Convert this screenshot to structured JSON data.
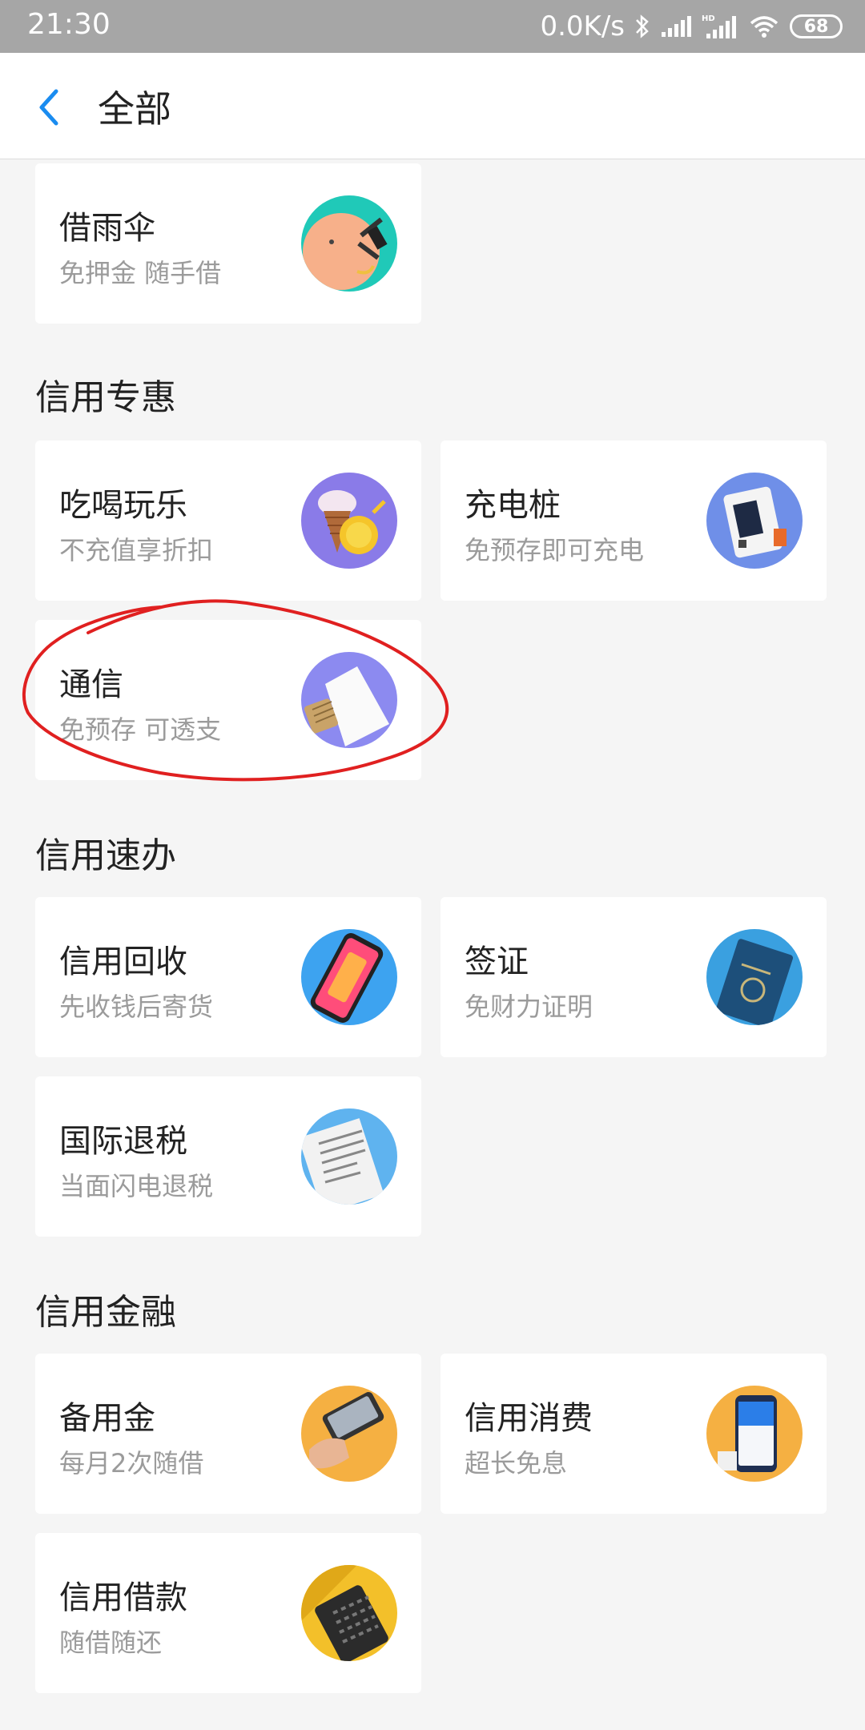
{
  "status_bar": {
    "time": "21:30",
    "net_speed": "0.0K/s",
    "battery": "68",
    "icons": [
      "bluetooth-icon",
      "signal-icon",
      "hd-signal-icon",
      "wifi-icon",
      "battery-icon"
    ]
  },
  "header": {
    "back_icon": "chevron-left-icon",
    "title": "全部",
    "accent_color": "#1a8cf0"
  },
  "top_card": {
    "title": "借雨伞",
    "subtitle": "免押金 随手借",
    "icon": "umbrella-icon"
  },
  "sections": [
    {
      "title": "信用专惠",
      "items": [
        {
          "title": "吃喝玩乐",
          "subtitle": "不充值享折扣",
          "icon": "ice-cream-icon"
        },
        {
          "title": "充电桩",
          "subtitle": "免预存即可充电",
          "icon": "charging-station-icon"
        },
        {
          "title": "通信",
          "subtitle": "免预存 可透支",
          "icon": "sim-card-icon"
        }
      ]
    },
    {
      "title": "信用速办",
      "items": [
        {
          "title": "信用回收",
          "subtitle": "先收钱后寄货",
          "icon": "phone-icon"
        },
        {
          "title": "签证",
          "subtitle": "免财力证明",
          "icon": "passport-icon"
        },
        {
          "title": "国际退税",
          "subtitle": "当面闪电退税",
          "icon": "receipt-icon"
        }
      ]
    },
    {
      "title": "信用金融",
      "items": [
        {
          "title": "备用金",
          "subtitle": "每月2次随借",
          "icon": "hand-phone-icon"
        },
        {
          "title": "信用消费",
          "subtitle": "超长免息",
          "icon": "phone-app-icon"
        },
        {
          "title": "信用借款",
          "subtitle": "随借随还",
          "icon": "calculator-icon"
        }
      ]
    }
  ],
  "annotation": {
    "color": "#e02020",
    "target": "通信"
  }
}
